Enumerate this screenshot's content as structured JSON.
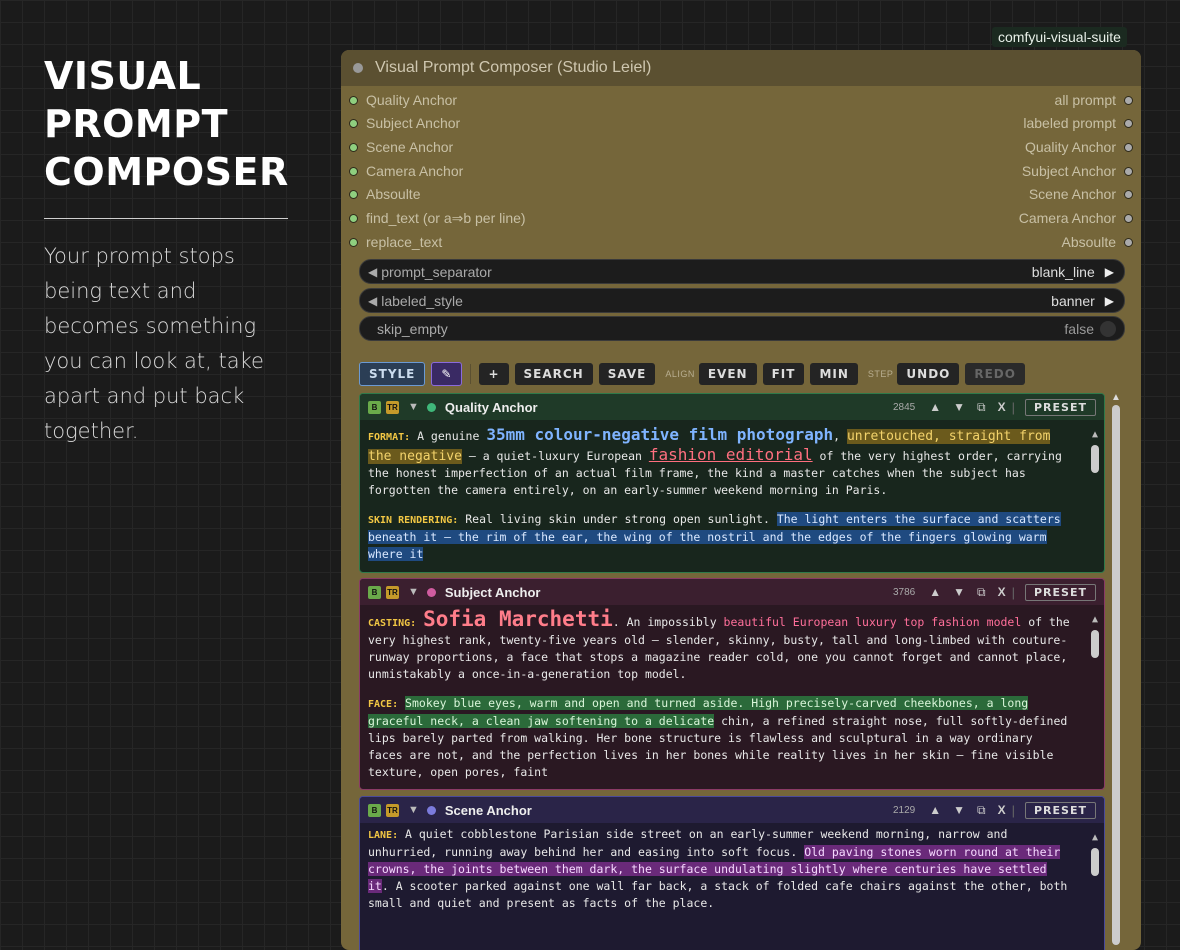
{
  "left": {
    "title_lines": [
      "VISUAL",
      "PROMPT",
      "COMPOSER"
    ],
    "tagline": "Your prompt stops being text and becomes something you can look at, take apart and put back together."
  },
  "suite_badge": "comfyui-visual-suite",
  "node": {
    "title": "Visual Prompt Composer (Studio Leiel)",
    "inputs": [
      "Quality Anchor",
      "Subject Anchor",
      "Scene Anchor",
      "Camera Anchor",
      "Absoulte",
      "find_text (or  a⇒b  per line)",
      "replace_text"
    ],
    "outputs": [
      "all prompt",
      "labeled prompt",
      "Quality Anchor",
      "Subject Anchor",
      "Scene Anchor",
      "Camera Anchor",
      "Absoulte"
    ],
    "widgets": {
      "prompt_separator": {
        "label": "prompt_separator",
        "value": "blank_line"
      },
      "labeled_style": {
        "label": "labeled_style",
        "value": "banner"
      },
      "skip_empty": {
        "label": "skip_empty",
        "value": "false"
      }
    },
    "toolbar": {
      "style": "STYLE",
      "pen_icon": "✎",
      "plus": "+",
      "search": "SEARCH",
      "save": "SAVE",
      "align_label": "ALIGN",
      "even": "EVEN",
      "fit": "FIT",
      "min": "MIN",
      "step_label": "STEP",
      "undo": "UNDO",
      "redo": "REDO"
    },
    "cards": [
      {
        "title": "Quality Anchor",
        "count": "2845",
        "color": "#3fb87a",
        "badge_b": "B",
        "badge_tr": "TR",
        "preset": "PRESET",
        "text": {
          "k1": "FORMAT:",
          "t1": " A genuine ",
          "h1": "35mm colour-negative film photograph",
          "t2": ", ",
          "h2": "unretouched, straight from the negative",
          "t3": " — a quiet-luxury European ",
          "h3": "fashion editorial",
          "t4": " of the very highest order, carrying the honest imperfection of an actual film frame, the kind a master catches when the subject has forgotten the camera entirely, on an early-summer weekend morning in Paris.",
          "k2": "SKIN RENDERING:",
          "t5": " Real living skin under strong open sunlight. ",
          "h4": "The light enters the surface and scatters beneath it — the rim of the ear, the wing of the nostril and the edges of the fingers glowing warm where it"
        }
      },
      {
        "title": "Subject Anchor",
        "count": "3786",
        "color": "#d05ca0",
        "badge_b": "B",
        "badge_tr": "TR",
        "preset": "PRESET",
        "text": {
          "k1": "CASTING:",
          "t0": " ",
          "h1": "Sofia Marchetti",
          "t1": ". An impossibly ",
          "h2": "beautiful European luxury top fashion model",
          "t2": " of the very highest rank, twenty-five years old — slender, skinny, busty, tall and long-limbed with couture-runway proportions, a face that stops a magazine reader cold, one you cannot forget and cannot place, unmistakably a once-in-a-generation top model.",
          "k2": "FACE:",
          "t3": " ",
          "h3": "Smokey blue eyes, warm and open and turned aside. High precisely-carved cheekbones, a long graceful neck, a clean jaw softening to a delicate",
          "t4": " chin, a refined straight nose, full softly-defined lips barely parted from walking. Her bone structure is flawless and sculptural in a way ordinary faces are not, and the perfection lives in her bones while reality lives in her skin — fine visible texture, open pores, faint"
        }
      },
      {
        "title": "Scene Anchor",
        "count": "2129",
        "color": "#7b7bdc",
        "badge_b": "B",
        "badge_tr": "TR",
        "preset": "PRESET",
        "text": {
          "k1": "LANE:",
          "t1": " A quiet cobblestone Parisian side street on an early-summer weekend morning, narrow and unhurried, running away behind her and easing into soft focus. ",
          "h1": "Old paving stones worn round at their crowns, the joints between them dark, the surface undulating slightly where centuries have settled it",
          "t2": ". A scooter parked against one wall far back, a stack of folded cafe chairs against the other, both small and quiet and present as facts of the place."
        }
      }
    ]
  }
}
